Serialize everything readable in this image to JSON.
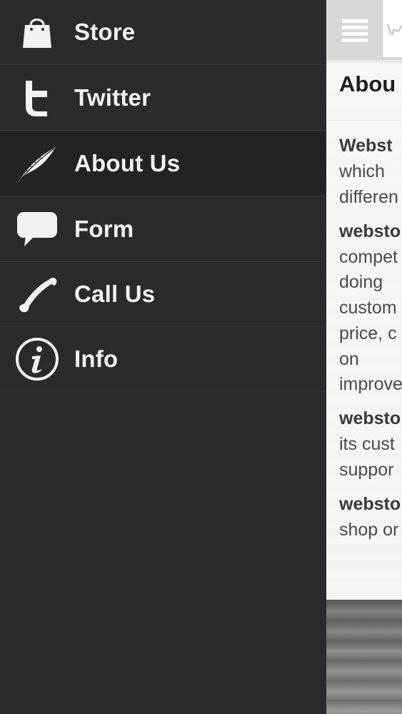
{
  "drawer": {
    "items": [
      {
        "label": "Store",
        "icon": "shopping-bag-icon",
        "active": false
      },
      {
        "label": "Twitter",
        "icon": "twitter-t-icon",
        "active": false
      },
      {
        "label": "About Us",
        "icon": "feather-icon",
        "active": true
      },
      {
        "label": "Form",
        "icon": "speech-bubble-icon",
        "active": false
      },
      {
        "label": "Call Us",
        "icon": "phone-handset-icon",
        "active": false
      },
      {
        "label": "Info",
        "icon": "info-circle-icon",
        "active": false
      }
    ]
  },
  "content": {
    "heading": "Abou",
    "lines": [
      {
        "text": "Webst",
        "bold": true
      },
      {
        "text": "which",
        "bold": false
      },
      {
        "text": "differen",
        "bold": false
      },
      {
        "text": "websto",
        "bold": true
      },
      {
        "text": "compet",
        "bold": false
      },
      {
        "text": "doing",
        "bold": false
      },
      {
        "text": "custom",
        "bold": false
      },
      {
        "text": "price, c",
        "bold": false
      },
      {
        "text": "on",
        "bold": false
      },
      {
        "text": "improve",
        "bold": false
      },
      {
        "text": "websto",
        "bold": true
      },
      {
        "text": "its cust",
        "bold": false
      },
      {
        "text": "suppor",
        "bold": false
      },
      {
        "text": "websto",
        "bold": true
      },
      {
        "text": "shop or",
        "bold": false
      }
    ]
  },
  "colors": {
    "drawer_bg": "#2c2a2c",
    "drawer_active_bg": "#242224",
    "drawer_text": "#f2f2f2"
  }
}
